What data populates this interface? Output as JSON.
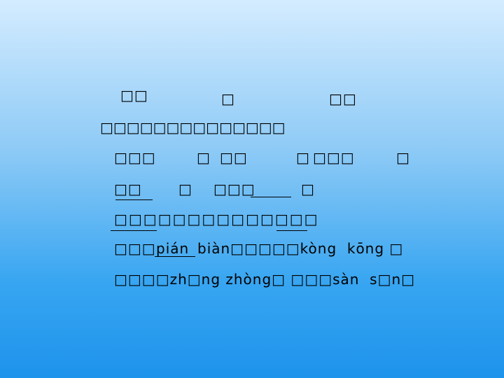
{
  "row1": {
    "a": "□□",
    "b": "□",
    "c": "□□"
  },
  "row2": {
    "a": "□□□□□□□□□□□□□□"
  },
  "row3": {
    "a": "□□□",
    "b": "□",
    "c": "□□",
    "d": "□",
    "e": "□□□",
    "f": "□"
  },
  "row4": {
    "a": "□□",
    "b": "□",
    "c": "□□□",
    "d": "□"
  },
  "row5": {
    "a": "□□□□□□□□□□□□□□"
  },
  "row6": {
    "a": "□□□",
    "b": "pián",
    "c": "biàn□□□□□kòng  kōng □"
  },
  "row7": {
    "a": "□□□□zh□ng zhòng□ □□□sàn  s□n□"
  }
}
